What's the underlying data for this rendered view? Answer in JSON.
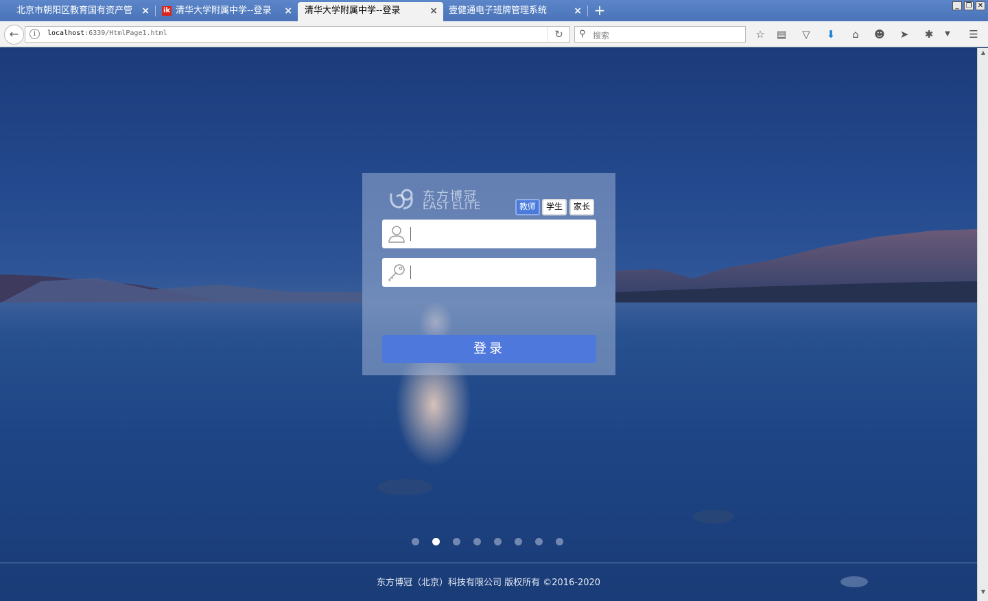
{
  "browser": {
    "tabs": [
      {
        "title": "北京市朝阳区教育国有资产管…",
        "favicon": "",
        "active": false
      },
      {
        "title": "清华大学附属中学--登录",
        "favicon": "ik",
        "active": false
      },
      {
        "title": "清华大学附属中学--登录",
        "favicon": "",
        "active": true
      },
      {
        "title": "壹健通电子班牌管理系统",
        "favicon": "",
        "active": false
      }
    ],
    "close_glyph": "×",
    "newtab_glyph": "+",
    "url_host": "localhost",
    "url_rest": ":6339/HtmlPage1.html",
    "search_placeholder": "搜索",
    "window_controls": [
      "_",
      "❐",
      "✕"
    ]
  },
  "login": {
    "logo_cn": "东方博冠",
    "logo_en": "EAST ELITE",
    "roles": [
      "教师",
      "学生",
      "家长"
    ],
    "active_role": "教师",
    "username_value": "",
    "password_value": "",
    "submit_label": "登录"
  },
  "carousel": {
    "count": 8,
    "active_index": 1
  },
  "footer": {
    "text": "东方博冠（北京）科技有限公司 版权所有 ©2016-2020"
  },
  "colors": {
    "accent": "#4f78dc",
    "active_role": "#4a7bdc",
    "tabbar": "#5c86c9"
  }
}
